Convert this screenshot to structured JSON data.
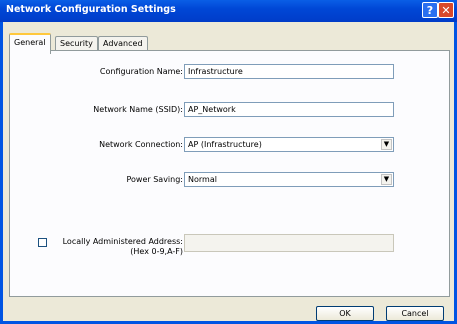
{
  "window": {
    "title": "Network Configuration Settings",
    "help_button": "?",
    "close_button": "✕"
  },
  "tabs": [
    {
      "label": "General",
      "active": true
    },
    {
      "label": "Security",
      "active": false
    },
    {
      "label": "Advanced",
      "active": false
    }
  ],
  "form": {
    "config_name_label": "Configuration Name:",
    "config_name_value": "Infrastructure",
    "ssid_label": "Network Name (SSID):",
    "ssid_value": "AP_Network",
    "connection_label": "Network Connection:",
    "connection_value": "AP (Infrastructure)",
    "power_label": "Power Saving:",
    "power_value": "Normal",
    "laa_label_line1": "Locally Administered Address:",
    "laa_label_line2": "(Hex 0-9,A-F)",
    "laa_value": "",
    "laa_checked": false
  },
  "buttons": {
    "ok": "OK",
    "cancel": "Cancel"
  },
  "icons": {
    "dropdown": "▼"
  }
}
